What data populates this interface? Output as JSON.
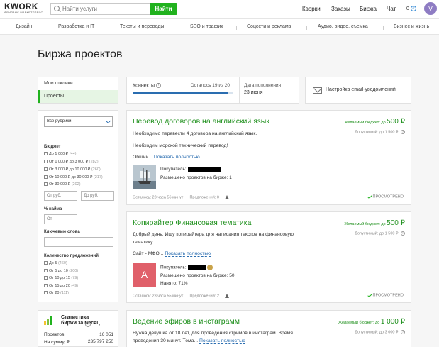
{
  "header": {
    "logo": "KWORK",
    "logo_sub": "ФРИЛАНС МАРКЕТПЛЕЙС",
    "search_placeholder": "Найти услуги",
    "search_button": "Найти",
    "nav": [
      "Кворки",
      "Заказы",
      "Биржа",
      "Чат"
    ],
    "balance": "0",
    "balance_currency": "₽",
    "avatar_letter": "V"
  },
  "categories": [
    "Дизайн",
    "Разработка и IT",
    "Тексты и переводы",
    "SEO и трафик",
    "Соцсети и реклама",
    "Аудио, видео, съемка",
    "Бизнес и жизнь"
  ],
  "page_title": "Биржа проектов",
  "left_menu": [
    "Мои отклики",
    "Проекты"
  ],
  "filters": {
    "rubric": "Все рубрики",
    "budget_label": "Бюджет",
    "budget_options": [
      {
        "label": "До 1 000 ₽",
        "count": "(44)"
      },
      {
        "label": "От 1 000 ₽ до 3 000 ₽",
        "count": "(282)"
      },
      {
        "label": "От 3 000 ₽ до 10 000 ₽",
        "count": "(260)"
      },
      {
        "label": "От 10 000 ₽ до 30 000 ₽",
        "count": "(217)"
      },
      {
        "label": "От 30 000 ₽",
        "count": "(202)"
      }
    ],
    "from_placeholder": "От руб.",
    "to_placeholder": "До руб.",
    "hired_label": "% найма",
    "hired_placeholder": "От",
    "keywords_label": "Ключевые слова",
    "offers_label": "Количество предложений",
    "offers_options": [
      {
        "label": "До 5",
        "count": "(460)"
      },
      {
        "label": "От 5 до 10",
        "count": "(200)"
      },
      {
        "label": "От 10 до 15",
        "count": "(79)"
      },
      {
        "label": "От 15 до 20",
        "count": "(49)"
      },
      {
        "label": "От 20",
        "count": "(111)"
      }
    ]
  },
  "stats": {
    "title": "Статистика биржи за месяц",
    "help": "?",
    "rows": [
      {
        "label": "Проектов",
        "value": "16 051"
      },
      {
        "label": "На сумму, ₽",
        "value": "235 797 250"
      }
    ]
  },
  "connects": {
    "label": "Коннекты",
    "help": "?",
    "left_text": "Осталось 19 из 20",
    "progress": 0.95,
    "refill_label": "Дата пополнения",
    "refill_date": "23 июня"
  },
  "email_setting": "Настройка email-уведомлений",
  "projects": [
    {
      "title": "Перевод договоров на английский язык",
      "budget_wanted_label": "Желаемый бюджет: до",
      "budget_wanted": "500 ₽",
      "budget_allowed": "Допустимый: до 1 500 ₽",
      "desc1": "Необходимо перевести 4 договора на английский язык.",
      "desc2": "Необходим морской технический перевод!",
      "desc3": "Общий...",
      "show_more": "Показать полностью",
      "buyer_label": "Покупатель:",
      "buyer_posted": "Размещено проектов на бирже: 1",
      "time_left": "Осталось: 23 часа 56 минут",
      "offers": "Предложений: 0",
      "viewed": "ПРОСМОТРЕНО"
    },
    {
      "title": "Копирайтер Финансовая тематика",
      "budget_wanted_label": "Желаемый бюджет: до",
      "budget_wanted": "500 ₽",
      "budget_allowed": "Допустимый: до 1 500 ₽",
      "desc1": "Добрый день. Ищу копирайтера для написания текстов на финансовую",
      "desc2": "тематику.",
      "desc3": "Сайт - МФО...",
      "show_more": "Показать полностью",
      "buyer_letter": "A",
      "buyer_label": "Покупатель:",
      "buyer_posted": "Размещено проектов на бирже: 50",
      "buyer_hired": "Нанято: 71%",
      "time_left": "Осталось: 23 часа 55 минут",
      "offers": "Предложений: 2",
      "viewed": "ПРОСМОТРЕНО"
    },
    {
      "title": "Ведение эфиров в инстаграмм",
      "budget_wanted_label": "Желаемый бюджет: до",
      "budget_wanted": "1 000 ₽",
      "budget_allowed": "Допустимый: до 3 000 ₽",
      "desc1": "Нужна девушка от 18 лет, для проведения стримов в инстаграм. Время",
      "desc2": "проведения 30 минут. Тема...",
      "show_more": "Показать полностью"
    }
  ]
}
